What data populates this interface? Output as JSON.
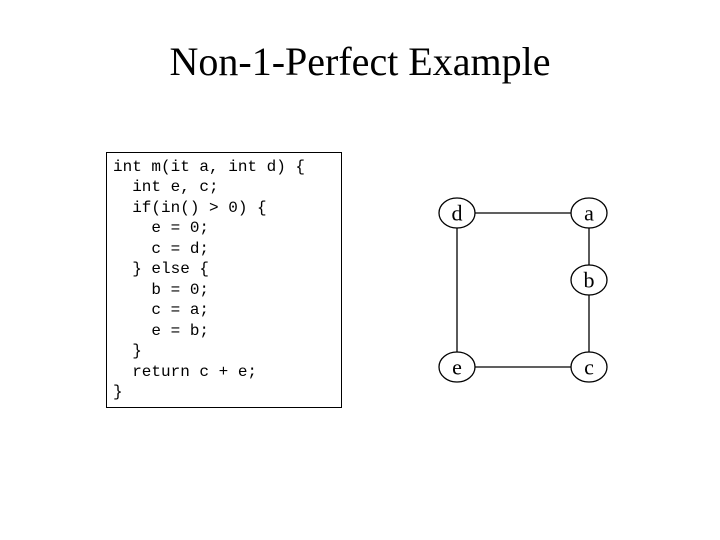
{
  "title": "Non-1-Perfect Example",
  "code": "int m(it a, int d) {\n  int e, c;\n  if(in() > 0) {\n    e = 0;\n    c = d;\n  } else {\n    b = 0;\n    c = a;\n    e = b;\n  }\n  return c + e;\n}",
  "graph": {
    "nodes": {
      "d": "d",
      "a": "a",
      "b": "b",
      "e": "e",
      "c": "c"
    }
  }
}
